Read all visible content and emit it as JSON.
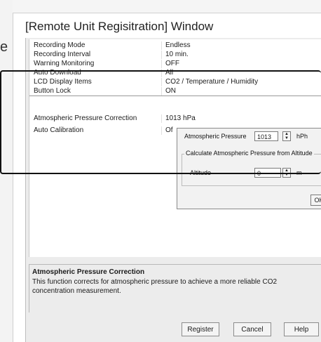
{
  "stray_char": "e",
  "window": {
    "title": "[Remote Unit Regisitration] Window"
  },
  "properties": [
    {
      "name": "Recording Mode",
      "value": "Endless"
    },
    {
      "name": "Recording Interval",
      "value": "10 min."
    },
    {
      "name": "Warning Monitoring",
      "value": "OFF"
    },
    {
      "name": "Auto Download",
      "value": "All"
    },
    {
      "name": "LCD Display Items",
      "value": "CO2 / Temperature / Humidity"
    },
    {
      "name": "Button Lock",
      "value": "ON"
    },
    {
      "name": "Atmospheric Pressure Correction",
      "value": "1013 hPa"
    },
    {
      "name": "Auto Calibration",
      "value": "Of"
    }
  ],
  "popup": {
    "pressure_label": "Atmospheric Pressure",
    "pressure_value": "1013",
    "pressure_unit": "hPh",
    "group_label": "Calculate Atmospheric Pressure from Altitude",
    "altitude_label": "Altitude",
    "altitude_value": "0",
    "altitude_unit": "m",
    "ok_label": "OK"
  },
  "description": {
    "title": "Atmospheric Pressure Correction",
    "text": "This function corrects for atmospheric pressure to achieve a more reliable CO2 concentration measurement."
  },
  "buttons": {
    "register": "Register",
    "cancel": "Cancel",
    "help": "Help"
  },
  "icons": {
    "spin_up": "up-arrow-icon",
    "spin_down": "down-arrow-icon"
  }
}
